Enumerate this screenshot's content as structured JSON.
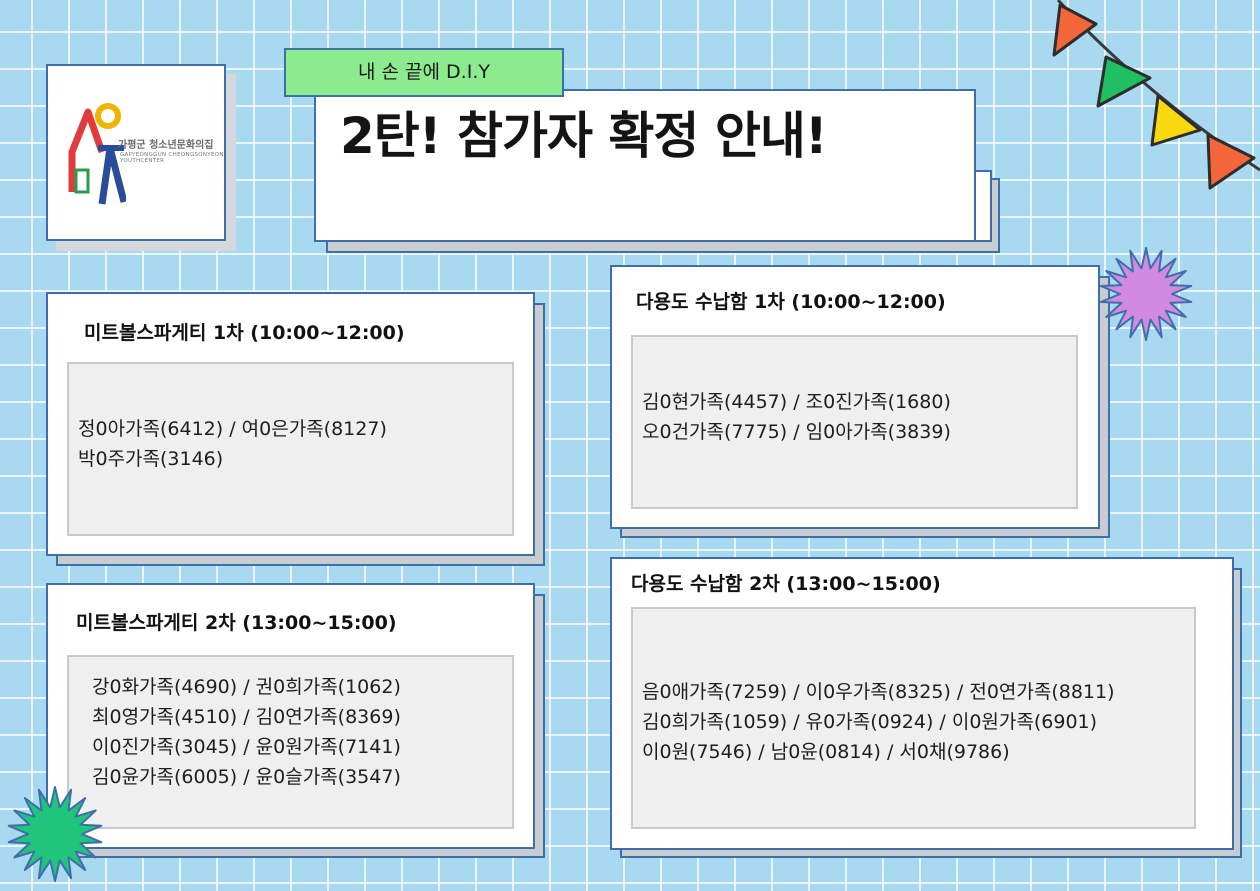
{
  "header": {
    "tag": "내 손 끝에 D.I.Y",
    "title": "2탄! 참가자 확정 안내!"
  },
  "logo": {
    "name": "가평군 청소년문화의집",
    "name_en": "GAPYEONGGUN CHEONGSONYEON YOUTHCENTER"
  },
  "panels": [
    {
      "title": "미트볼스파게티 1차 (10:00~12:00)",
      "lines": [
        "정0아가족(6412) / 여0은가족(8127)",
        "박0주가족(3146)"
      ]
    },
    {
      "title": "미트볼스파게티 2차 (13:00~15:00)",
      "lines": [
        "강0화가족(4690) / 권0희가족(1062)",
        "최0영가족(4510) / 김0연가족(8369)",
        "이0진가족(3045) / 윤0원가족(7141)",
        "김0윤가족(6005) / 윤0슬가족(3547)"
      ]
    },
    {
      "title": "다용도 수납함 1차 (10:00~12:00)",
      "lines": [
        "김0현가족(4457) / 조0진가족(1680)",
        "오0건가족(7775) / 임0아가족(3839)"
      ]
    },
    {
      "title": "다용도 수납함 2차 (13:00~15:00)",
      "lines": [
        "음0애가족(7259) / 이0우가족(8325) / 전0연가족(8811)",
        "김0희가족(1059) / 유0가족(0924) / 이0원가족(6901)",
        "이0원(7546) / 남0윤(0814) / 서0채(9786)"
      ]
    }
  ],
  "colors": {
    "background": "#a9d9f0",
    "border": "#3f6fa8",
    "tag": "#8ceb8e",
    "flag_orange": "#f2663a",
    "flag_green": "#1fbf62",
    "flag_yellow": "#f8d80e",
    "star_purple": "#d28ae0",
    "star_green": "#1fc57a"
  },
  "icons": [
    "logo-house-icon",
    "bunting-flags-icon",
    "purple-starburst-icon",
    "green-starburst-icon"
  ]
}
